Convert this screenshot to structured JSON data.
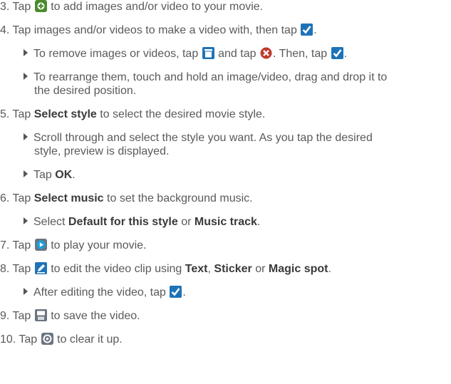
{
  "steps": {
    "s3": {
      "num": "3.",
      "a": "Tap",
      "b": "to add images and/or video to your movie."
    },
    "s4": {
      "num": "4.",
      "a": "Tap images and/or videos to make a video with, then tap",
      "b": "."
    },
    "s4_b1": {
      "a": "To remove images or videos, tap",
      "b": "and tap",
      "c": ". Then, tap",
      "d": "."
    },
    "s4_b2": {
      "a": "To rearrange them, touch and hold an image/video, drag and drop it to",
      "b": "the desired position."
    },
    "s5": {
      "num": "5.",
      "a": "Tap",
      "bold": "Select style",
      "b": "to select the desired movie style."
    },
    "s5_b1": {
      "a": "Scroll through and select the style you want. As you tap the desired",
      "b": "style, preview is displayed."
    },
    "s5_b2": {
      "a": "Tap",
      "bold": "OK",
      "b": "."
    },
    "s6": {
      "num": "6.",
      "a": "Tap",
      "bold": "Select music",
      "b": "to set the background music."
    },
    "s6_b1": {
      "a": "Select",
      "bold1": "Default for this style",
      "b": "or",
      "bold2": "Music track",
      "c": "."
    },
    "s7": {
      "num": "7.",
      "a": "Tap",
      "b": "to play your movie."
    },
    "s8": {
      "num": "8.",
      "a": "Tap",
      "b": "to edit the video clip using",
      "bold1": "Text",
      "c": ",",
      "bold2": "Sticker",
      "d": "or",
      "bold3": "Magic spot",
      "e": "."
    },
    "s8_b1": {
      "a": "After editing the video, tap",
      "b": "."
    },
    "s9": {
      "num": "9.",
      "a": "Tap",
      "b": "to save the video."
    },
    "s10": {
      "num": "10.",
      "a": "Tap",
      "b": "to clear it up."
    }
  },
  "icons": {
    "add": "add-media-icon",
    "check": "checkmark-icon",
    "trash": "trash-icon",
    "remove": "remove-x-icon",
    "play": "play-icon",
    "edit": "edit-pencil-icon",
    "save": "save-icon",
    "clear": "clear-reset-icon"
  },
  "colors": {
    "text": "#5a5a5a",
    "bold_text": "#3a3a3a",
    "icon_blue": "#1e73b8",
    "icon_green": "#4a8b2c",
    "icon_red": "#c0392b",
    "icon_gray": "#6b7480"
  }
}
